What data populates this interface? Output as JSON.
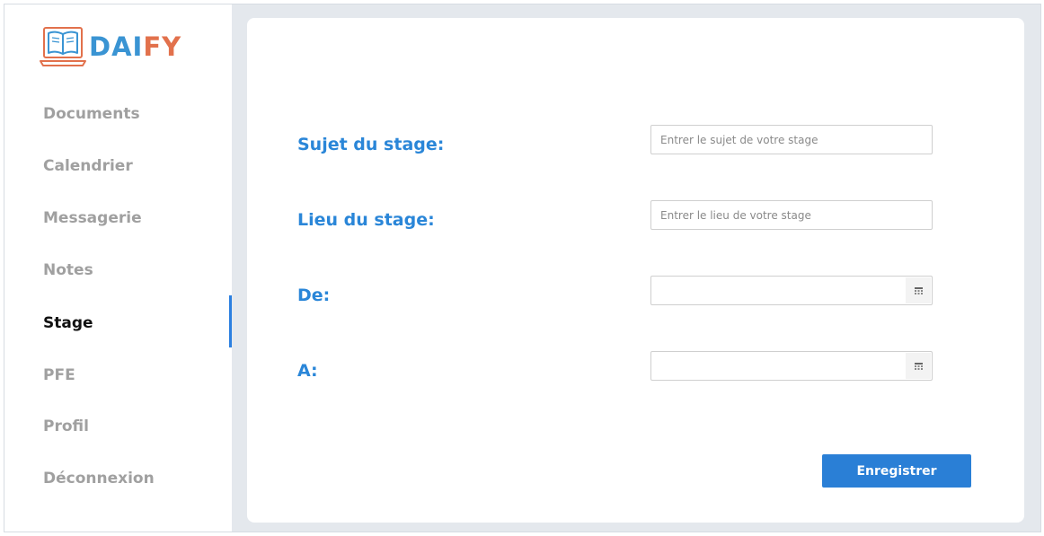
{
  "brand": {
    "name_part1": "DAI",
    "name_part2": "FY",
    "icon": "laptop-book-icon"
  },
  "colors": {
    "brand_blue": "#3a94d3",
    "brand_orange": "#e2714c",
    "accent": "#2a7fd6",
    "label": "#2a86d8"
  },
  "sidebar": {
    "items": [
      {
        "label": "Documents"
      },
      {
        "label": "Calendrier"
      },
      {
        "label": "Messagerie"
      },
      {
        "label": "Notes"
      },
      {
        "label": "Stage",
        "active": true
      },
      {
        "label": "PFE"
      },
      {
        "label": "Profil"
      },
      {
        "label": "Déconnexion"
      }
    ]
  },
  "form": {
    "subject": {
      "label": "Sujet du stage:",
      "placeholder": "Entrer le sujet de votre stage",
      "value": ""
    },
    "place": {
      "label": "Lieu du stage:",
      "placeholder": "Entrer le lieu de votre stage",
      "value": ""
    },
    "from": {
      "label": "De:",
      "value": "",
      "icon": "calendar-icon"
    },
    "to": {
      "label": "A:",
      "value": "",
      "icon": "calendar-icon"
    },
    "submit_label": "Enregistrer"
  }
}
